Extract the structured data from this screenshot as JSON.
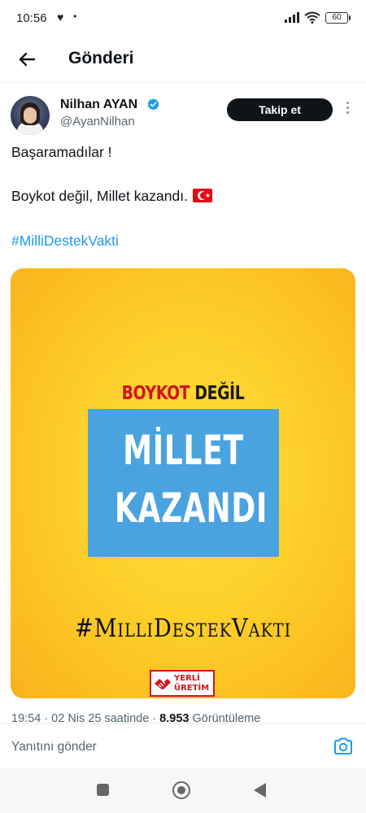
{
  "status_bar": {
    "time": "10:56",
    "heart_icon": "heart-icon",
    "dot": "•",
    "battery": "60"
  },
  "header": {
    "title": "Gönderi",
    "back_icon": "arrow-left-icon"
  },
  "tweet": {
    "author_name": "Nilhan AYAN",
    "author_handle": "@AyanNilhan",
    "verified_icon": "verified-badge-icon",
    "follow_label": "Takip et",
    "more_icon": "more-vertical-icon",
    "line1": "Başaramadılar !",
    "line2": "Boykot değil, Millet kazandı.",
    "flag_icon": "turkey-flag-icon",
    "hashtag": "#MilliDestekVakti",
    "timestamp_prefix": "19:54 · 02 Nis 25 saatinde · ",
    "views_count": "8.953",
    "views_label": " Görüntüleme",
    "accent_color": "#1d9bf0"
  },
  "media": {
    "boykot_word": "BOYKOT",
    "degil_word": " DEĞİL",
    "millet": "MİLLET",
    "kazandi": "KAZANDI",
    "hashtag_text": "#MilliDestekVakti",
    "logo_line1": "YERLİ",
    "logo_line2": "ÜRETİM",
    "colors": {
      "background": "#fdd02a",
      "box": "#4aa3df",
      "red": "#d4121b"
    }
  },
  "reply_bar": {
    "placeholder": "Yanıtını gönder",
    "camera_icon": "camera-icon"
  },
  "nav_bar": {
    "recents_icon": "recents-square-icon",
    "home_icon": "home-circle-icon",
    "back_icon": "back-triangle-icon"
  }
}
